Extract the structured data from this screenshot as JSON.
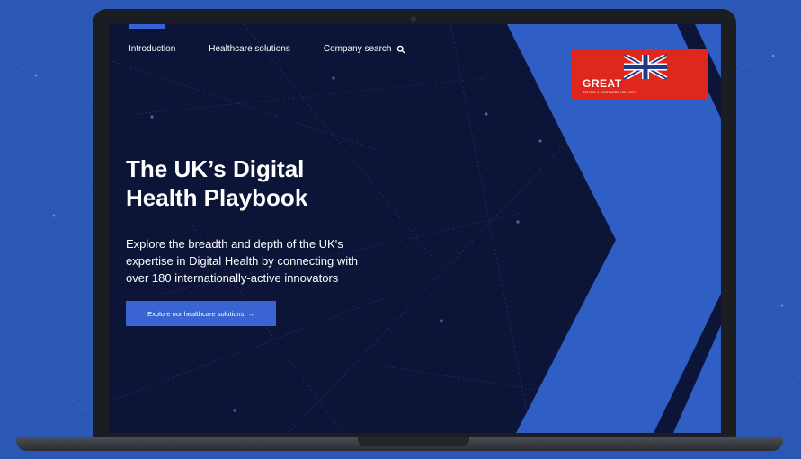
{
  "nav": {
    "items": [
      {
        "label": "Introduction"
      },
      {
        "label": "Healthcare solutions"
      }
    ],
    "search_label": "Company search"
  },
  "logo": {
    "text": "GREAT",
    "subtext": "BRITAIN & NORTHERN IRELAND"
  },
  "hero": {
    "title_line1": "The UK’s Digital",
    "title_line2": "Health Playbook",
    "desc_line1": "Explore the breadth and depth of the UK's",
    "desc_line2": "expertise in Digital Health by connecting with",
    "desc_line3": "over 180 internationally-active innovators",
    "cta_label": "Explore our healthcare solutions",
    "cta_arrow": "→"
  },
  "colors": {
    "page_background": "#2b57b5",
    "screen_background": "#0c1437",
    "accent_blue": "#2f5fc4",
    "logo_red": "#e0271e",
    "button_blue": "#3a64d1"
  },
  "icons": {
    "search": "search-icon",
    "union_flag": "union-flag-icon",
    "arrow": "arrow-right-icon"
  }
}
